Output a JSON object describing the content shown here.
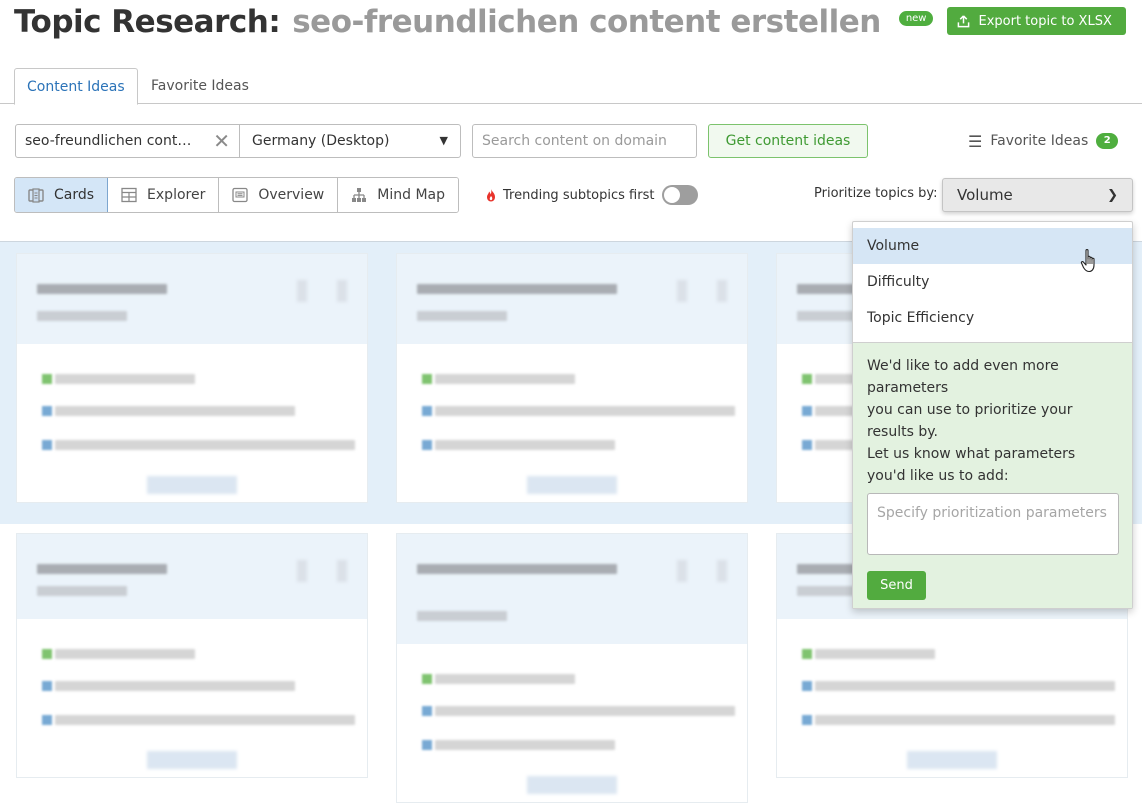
{
  "header": {
    "title": "Topic Research:",
    "topic": "seo-freundlichen content erstellen",
    "badge": "new",
    "export_label": "Export topic to XLSX"
  },
  "tabs": [
    {
      "label": "Content Ideas",
      "active": true
    },
    {
      "label": "Favorite Ideas",
      "active": false
    }
  ],
  "search": {
    "query": "seo-freundlichen cont…",
    "region": "Germany (Desktop)",
    "domain_placeholder": "Search content on domain",
    "domain_value": "",
    "get_ideas_label": "Get content ideas",
    "favorites_label": "Favorite Ideas",
    "favorites_count": "2"
  },
  "view_modes": [
    {
      "label": "Cards",
      "icon": "cards-icon",
      "active": true
    },
    {
      "label": "Explorer",
      "icon": "table-icon",
      "active": false
    },
    {
      "label": "Overview",
      "icon": "overview-icon",
      "active": false
    },
    {
      "label": "Mind Map",
      "icon": "mindmap-icon",
      "active": false
    }
  ],
  "trending": {
    "label": "Trending subtopics first",
    "enabled": false
  },
  "prioritize": {
    "label": "Prioritize topics by:",
    "selected": "Volume",
    "options": [
      "Volume",
      "Difficulty",
      "Topic Efficiency"
    ],
    "hovered": "Volume"
  },
  "feedback": {
    "lines": [
      "We'd like to add even more",
      "parameters",
      "you can use to prioritize your",
      "results by.",
      "Let us know what parameters",
      "you'd like us to add:"
    ],
    "input_placeholder": "Specify prioritization parameters",
    "send_label": "Send"
  },
  "colors": {
    "brand_green": "#52ab3f",
    "link_blue": "#2b73b8",
    "active_view_bg": "#d4e6f7",
    "hover_option_bg": "#d6e6f5",
    "feedback_bg": "#e3f2e0"
  }
}
